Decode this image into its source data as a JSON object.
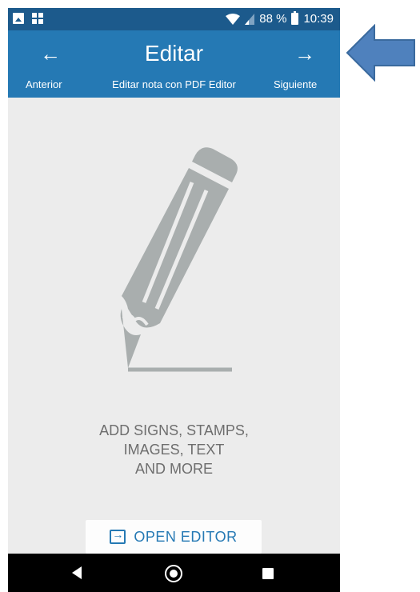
{
  "status_bar": {
    "battery": "88 %",
    "time": "10:39"
  },
  "app_bar": {
    "title": "Editar",
    "subtitle": "Editar nota con PDF Editor",
    "prev_label": "Anterior",
    "next_label": "Siguiente",
    "prev_arrow": "←",
    "next_arrow": "→"
  },
  "main": {
    "promo_line1": "ADD SIGNS, STAMPS,",
    "promo_line2": "IMAGES, TEXT",
    "promo_line3": "AND MORE",
    "open_editor_label": "OPEN EDITOR"
  },
  "colors": {
    "status_bar": "#1c5a8c",
    "app_bar": "#2579b4",
    "background": "#ececec",
    "pencil": "#a9aeae",
    "annotation_arrow": "#4f81bd"
  }
}
